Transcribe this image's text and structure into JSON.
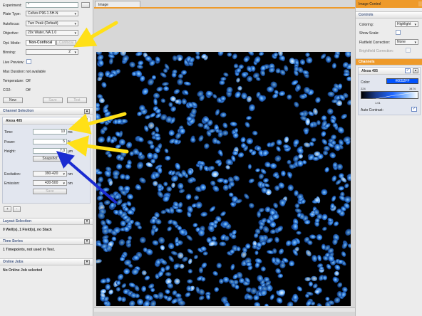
{
  "left": {
    "experiment": {
      "label": "Experiment:",
      "value": "*"
    },
    "plate_type": {
      "label": "Plate Type:",
      "value": "Cellvis P96-1.5H-N"
    },
    "autofocus": {
      "label": "Autofocus:",
      "value": "Two Peak (Default)"
    },
    "objective": {
      "label": "Objective:",
      "value": "20x Water, NA 1.0"
    },
    "opt_mode": {
      "label": "Opt. Mode:",
      "active": "Non-Confocal",
      "inactive": "Confocal"
    },
    "binning": {
      "label": "Binning:",
      "value": "2"
    },
    "live_preview": {
      "label": "Live Preview:"
    },
    "max_duration": {
      "label": "Max Duration:",
      "value": "not available"
    },
    "temperature": {
      "label": "Temperature:",
      "value": "Off"
    },
    "co2": {
      "label": "CO2:",
      "value": "Off"
    },
    "buttons": {
      "new": "New",
      "save": "Save",
      "test": "Test"
    },
    "channel_selection": {
      "title": "Channel Selection",
      "channel": "Alexa 405",
      "time": {
        "label": "Time:",
        "value": "10",
        "unit": "ms"
      },
      "power": {
        "label": "Power:",
        "value": "5",
        "unit": "%"
      },
      "height": {
        "label": "Height:",
        "value": "7.0",
        "unit": "µm"
      },
      "snapshot": "Snapshot",
      "excitation": {
        "label": "Excitation:",
        "value": "390-420",
        "unit": "nm"
      },
      "emission": {
        "label": "Emission:",
        "value": "430-500",
        "unit": "nm"
      },
      "save": "Save",
      "add": "+",
      "remove": "-"
    },
    "layout_selection": {
      "title": "Layout Selection",
      "info": "0 Well(s), 1 Field(s), no Stack"
    },
    "time_series": {
      "title": "Time Series",
      "info": "1 Timepoints, not used in Test."
    },
    "online_jobs": {
      "title": "Online Jobs",
      "info": "No Online Job selected"
    }
  },
  "main": {
    "tab": "Image"
  },
  "right": {
    "title": "Image Control",
    "controls": {
      "title": "Controls",
      "coloring": {
        "label": "Coloring:",
        "value": "Highlight"
      },
      "show_scale": {
        "label": "Show Scale:"
      },
      "flatfield": {
        "label": "Flatfield Correction:",
        "value": "None"
      },
      "brightfield": {
        "label": "Brightfield Correction:"
      }
    },
    "channels": {
      "title": "Channels",
      "channel": "Alexa 405",
      "color_label": "Color:",
      "color_value": "#0052FF",
      "scale_min": "224",
      "scale_max": "3474",
      "gamma": "1.01",
      "auto_contrast": "Auto Contrast:"
    }
  },
  "colors": {
    "accent": "#ee9a2a",
    "highlight": "#0052ff",
    "arrow_yellow": "#ffe017",
    "arrow_blue": "#1a2bd1"
  }
}
